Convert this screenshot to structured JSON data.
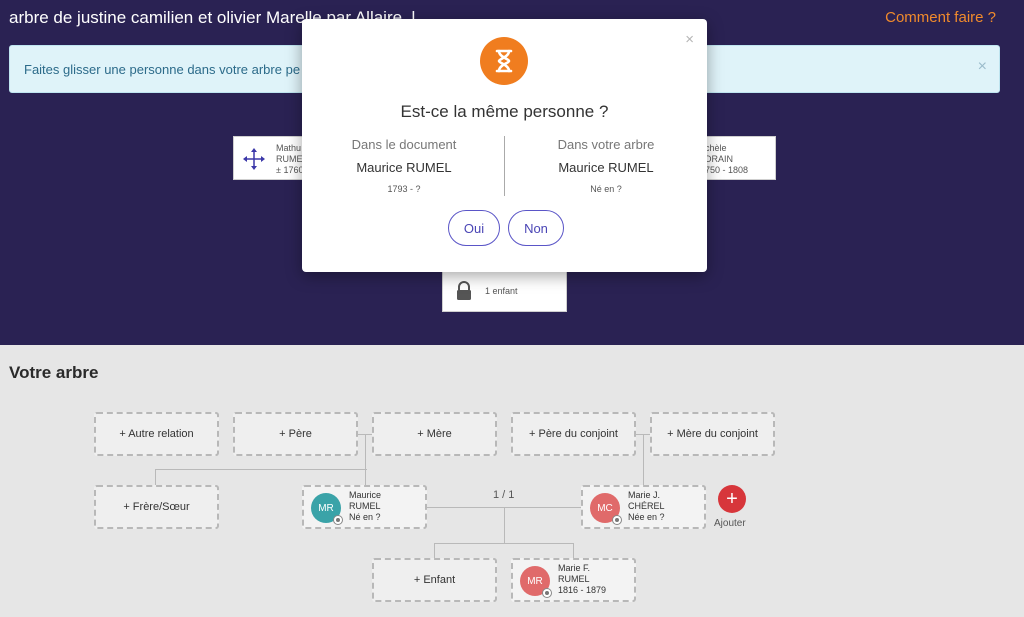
{
  "header": {
    "title": "arbre de justine camilien et olivier Marelle par Allaire_l",
    "help_link": "Comment faire ?"
  },
  "banner": {
    "text": "Faites glisser une personne dans votre arbre pe",
    "close": "×"
  },
  "document_cards": {
    "left": {
      "line1": "Mathu",
      "line2": "RUME",
      "line3": "± 1760"
    },
    "right": {
      "line1": "chèle",
      "line2": "DRAIN",
      "line3": "750 - 1808"
    },
    "child": {
      "text": "1 enfant"
    }
  },
  "tree": {
    "title": "Votre arbre",
    "buttons": {
      "autre_relation": "+ Autre relation",
      "pere": "+ Père",
      "mere": "+ Mère",
      "pere_conjoint": "+ Père du conjoint",
      "mere_conjoint": "+ Mère du conjoint",
      "frere_soeur": "+ Frère/Sœur",
      "enfant": "+ Enfant"
    },
    "counter": "1 / 1",
    "add_label": "Ajouter",
    "add_symbol": "+",
    "persons": [
      {
        "initials": "MR",
        "line1": "Maurice",
        "line2": "RUMEL",
        "line3": "Né en ?",
        "color": "#3aa3a8"
      },
      {
        "initials": "MC",
        "line1": "Marie J.",
        "line2": "CHÉREL",
        "line3": "Née en ?",
        "color": "#e06a6a"
      },
      {
        "initials": "MR",
        "line1": "Marie F.",
        "line2": "RUMEL",
        "line3": "1816 - 1879",
        "color": "#e06a6a"
      }
    ]
  },
  "modal": {
    "question": "Est-ce la même personne ?",
    "close": "×",
    "left": {
      "heading": "Dans le document",
      "name": "Maurice RUMEL",
      "dates": "1793 - ?"
    },
    "right": {
      "heading": "Dans votre arbre",
      "name": "Maurice RUMEL",
      "dates": "Né en ?"
    },
    "yes": "Oui",
    "no": "Non"
  },
  "colors": {
    "header_bg": "#2a2253",
    "accent_orange": "#f07d1f",
    "pill_purple": "#4a45b5",
    "add_red": "#d7363b"
  }
}
